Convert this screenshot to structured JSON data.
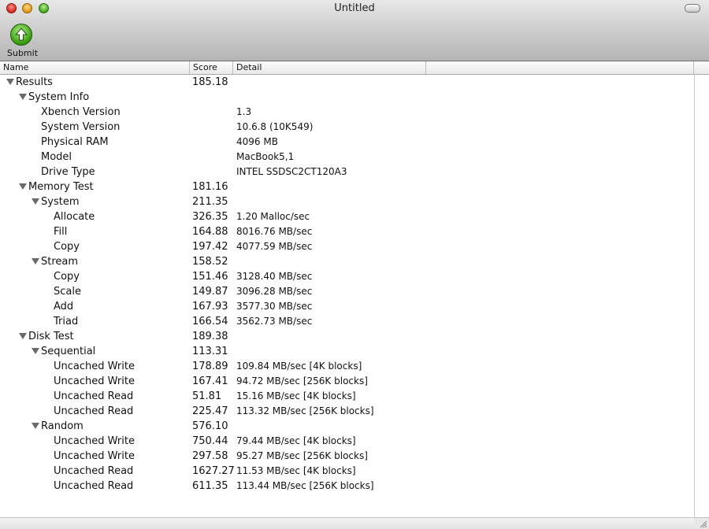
{
  "window": {
    "title": "Untitled"
  },
  "toolbar": {
    "submit_label": "Submit"
  },
  "columns": {
    "name": "Name",
    "score": "Score",
    "detail": "Detail"
  },
  "rows": [
    {
      "indent": 0,
      "expandable": true,
      "name": "Results",
      "score": "185.18",
      "detail": ""
    },
    {
      "indent": 1,
      "expandable": true,
      "name": "System Info",
      "score": "",
      "detail": ""
    },
    {
      "indent": 2,
      "expandable": false,
      "name": "Xbench Version",
      "score": "",
      "detail": "1.3"
    },
    {
      "indent": 2,
      "expandable": false,
      "name": "System Version",
      "score": "",
      "detail": "10.6.8 (10K549)"
    },
    {
      "indent": 2,
      "expandable": false,
      "name": "Physical RAM",
      "score": "",
      "detail": "4096 MB"
    },
    {
      "indent": 2,
      "expandable": false,
      "name": "Model",
      "score": "",
      "detail": "MacBook5,1"
    },
    {
      "indent": 2,
      "expandable": false,
      "name": "Drive Type",
      "score": "",
      "detail": "INTEL SSDSC2CT120A3"
    },
    {
      "indent": 1,
      "expandable": true,
      "name": "Memory Test",
      "score": "181.16",
      "detail": ""
    },
    {
      "indent": 2,
      "expandable": true,
      "name": "System",
      "score": "211.35",
      "detail": ""
    },
    {
      "indent": 3,
      "expandable": false,
      "name": "Allocate",
      "score": "326.35",
      "detail": "1.20 Malloc/sec"
    },
    {
      "indent": 3,
      "expandable": false,
      "name": "Fill",
      "score": "164.88",
      "detail": "8016.76 MB/sec"
    },
    {
      "indent": 3,
      "expandable": false,
      "name": "Copy",
      "score": "197.42",
      "detail": "4077.59 MB/sec"
    },
    {
      "indent": 2,
      "expandable": true,
      "name": "Stream",
      "score": "158.52",
      "detail": ""
    },
    {
      "indent": 3,
      "expandable": false,
      "name": "Copy",
      "score": "151.46",
      "detail": "3128.40 MB/sec"
    },
    {
      "indent": 3,
      "expandable": false,
      "name": "Scale",
      "score": "149.87",
      "detail": "3096.28 MB/sec"
    },
    {
      "indent": 3,
      "expandable": false,
      "name": "Add",
      "score": "167.93",
      "detail": "3577.30 MB/sec"
    },
    {
      "indent": 3,
      "expandable": false,
      "name": "Triad",
      "score": "166.54",
      "detail": "3562.73 MB/sec"
    },
    {
      "indent": 1,
      "expandable": true,
      "name": "Disk Test",
      "score": "189.38",
      "detail": ""
    },
    {
      "indent": 2,
      "expandable": true,
      "name": "Sequential",
      "score": "113.31",
      "detail": ""
    },
    {
      "indent": 3,
      "expandable": false,
      "name": "Uncached Write",
      "score": "178.89",
      "detail": "109.84 MB/sec [4K blocks]"
    },
    {
      "indent": 3,
      "expandable": false,
      "name": "Uncached Write",
      "score": "167.41",
      "detail": "94.72 MB/sec [256K blocks]"
    },
    {
      "indent": 3,
      "expandable": false,
      "name": "Uncached Read",
      "score": "51.81",
      "detail": "15.16 MB/sec [4K blocks]"
    },
    {
      "indent": 3,
      "expandable": false,
      "name": "Uncached Read",
      "score": "225.47",
      "detail": "113.32 MB/sec [256K blocks]"
    },
    {
      "indent": 2,
      "expandable": true,
      "name": "Random",
      "score": "576.10",
      "detail": ""
    },
    {
      "indent": 3,
      "expandable": false,
      "name": "Uncached Write",
      "score": "750.44",
      "detail": "79.44 MB/sec [4K blocks]"
    },
    {
      "indent": 3,
      "expandable": false,
      "name": "Uncached Write",
      "score": "297.58",
      "detail": "95.27 MB/sec [256K blocks]"
    },
    {
      "indent": 3,
      "expandable": false,
      "name": "Uncached Read",
      "score": "1627.27",
      "detail": "11.53 MB/sec [4K blocks]"
    },
    {
      "indent": 3,
      "expandable": false,
      "name": "Uncached Read",
      "score": "611.35",
      "detail": "113.44 MB/sec [256K blocks]"
    }
  ]
}
